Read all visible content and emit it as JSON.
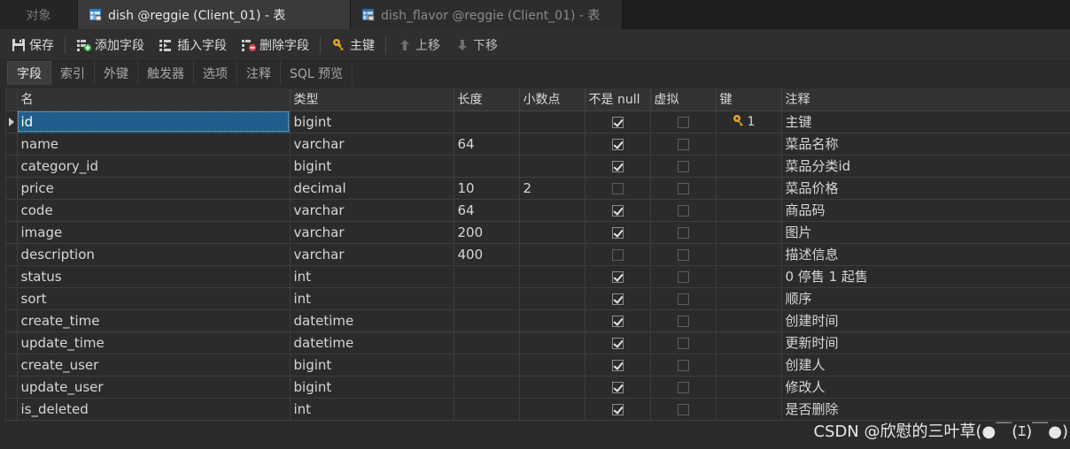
{
  "tabs": {
    "objects": "对象",
    "active": "dish @reggie (Client_01) - 表",
    "inactive": "dish_flavor @reggie (Client_01) - 表"
  },
  "toolbar": {
    "save": "保存",
    "add_field": "添加字段",
    "insert_field": "插入字段",
    "delete_field": "删除字段",
    "primary_key": "主键",
    "move_up": "上移",
    "move_down": "下移"
  },
  "subtabs": [
    "字段",
    "索引",
    "外键",
    "触发器",
    "选项",
    "注释",
    "SQL 预览"
  ],
  "columns": {
    "name": "名",
    "type": "类型",
    "length": "长度",
    "decimals": "小数点",
    "not_null": "不是 null",
    "virtual": "虚拟",
    "key": "键",
    "comment": "注释"
  },
  "rows": [
    {
      "name": "id",
      "type": "bigint",
      "length": "",
      "decimals": "",
      "not_null": true,
      "virtual": false,
      "key": "1",
      "comment": "主键"
    },
    {
      "name": "name",
      "type": "varchar",
      "length": "64",
      "decimals": "",
      "not_null": true,
      "virtual": false,
      "key": "",
      "comment": "菜品名称"
    },
    {
      "name": "category_id",
      "type": "bigint",
      "length": "",
      "decimals": "",
      "not_null": true,
      "virtual": false,
      "key": "",
      "comment": "菜品分类id"
    },
    {
      "name": "price",
      "type": "decimal",
      "length": "10",
      "decimals": "2",
      "not_null": false,
      "virtual": false,
      "key": "",
      "comment": "菜品价格"
    },
    {
      "name": "code",
      "type": "varchar",
      "length": "64",
      "decimals": "",
      "not_null": true,
      "virtual": false,
      "key": "",
      "comment": "商品码"
    },
    {
      "name": "image",
      "type": "varchar",
      "length": "200",
      "decimals": "",
      "not_null": true,
      "virtual": false,
      "key": "",
      "comment": "图片"
    },
    {
      "name": "description",
      "type": "varchar",
      "length": "400",
      "decimals": "",
      "not_null": false,
      "virtual": false,
      "key": "",
      "comment": "描述信息"
    },
    {
      "name": "status",
      "type": "int",
      "length": "",
      "decimals": "",
      "not_null": true,
      "virtual": false,
      "key": "",
      "comment": "0 停售 1 起售"
    },
    {
      "name": "sort",
      "type": "int",
      "length": "",
      "decimals": "",
      "not_null": true,
      "virtual": false,
      "key": "",
      "comment": "顺序"
    },
    {
      "name": "create_time",
      "type": "datetime",
      "length": "",
      "decimals": "",
      "not_null": true,
      "virtual": false,
      "key": "",
      "comment": "创建时间"
    },
    {
      "name": "update_time",
      "type": "datetime",
      "length": "",
      "decimals": "",
      "not_null": true,
      "virtual": false,
      "key": "",
      "comment": "更新时间"
    },
    {
      "name": "create_user",
      "type": "bigint",
      "length": "",
      "decimals": "",
      "not_null": true,
      "virtual": false,
      "key": "",
      "comment": "创建人"
    },
    {
      "name": "update_user",
      "type": "bigint",
      "length": "",
      "decimals": "",
      "not_null": true,
      "virtual": false,
      "key": "",
      "comment": "修改人"
    },
    {
      "name": "is_deleted",
      "type": "int",
      "length": "",
      "decimals": "",
      "not_null": true,
      "virtual": false,
      "key": "",
      "comment": "是否删除"
    }
  ],
  "watermark": "CSDN @欣慰的三叶草(●￣(ｴ)￣●)",
  "colors": {
    "selection": "#1f5d8a",
    "key_icon": "#e0a526",
    "background": "#2b2b2b"
  }
}
